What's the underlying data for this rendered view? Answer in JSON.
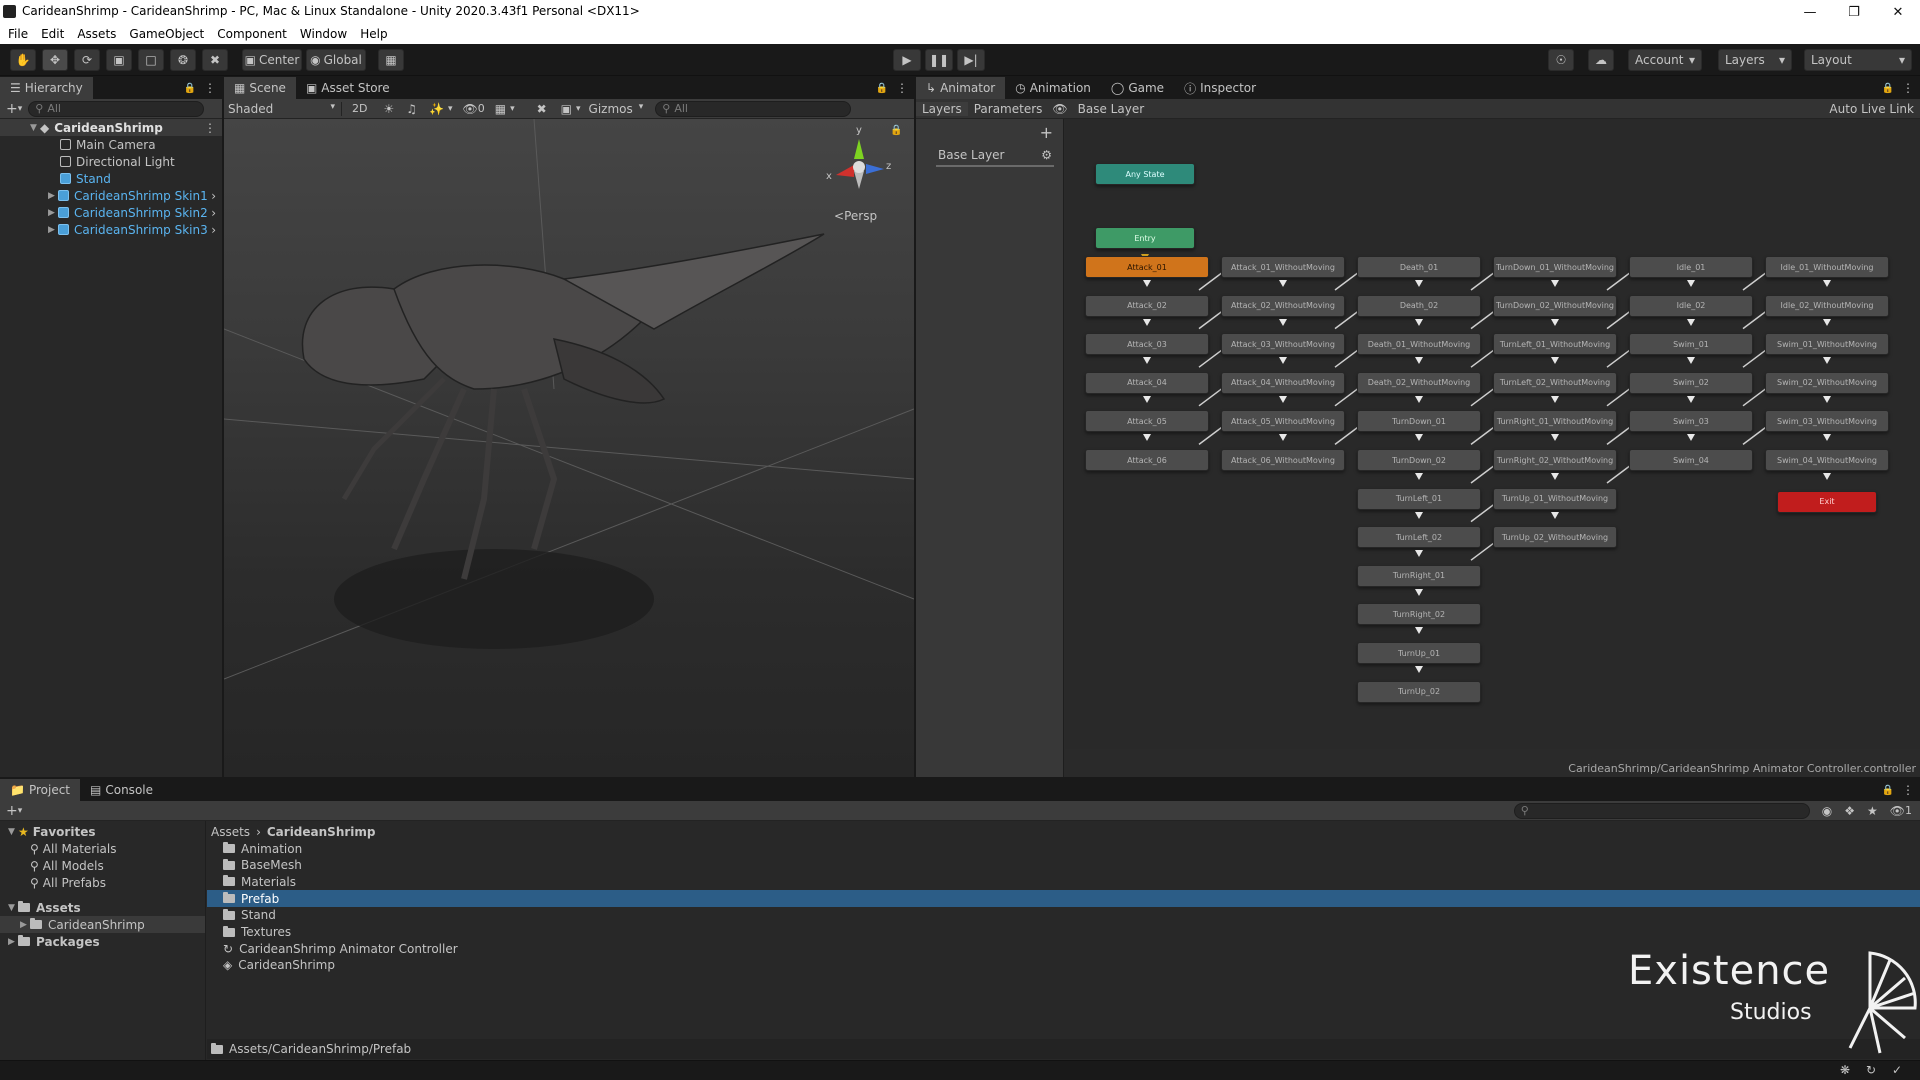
{
  "window": {
    "title": "CarideanShrimp - CarideanShrimp - PC, Mac & Linux Standalone - Unity 2020.3.43f1 Personal <DX11>"
  },
  "menu": [
    "File",
    "Edit",
    "Assets",
    "GameObject",
    "Component",
    "Window",
    "Help"
  ],
  "toolbar": {
    "pivot_label": "Center",
    "space_label": "Global",
    "account_label": "Account",
    "layers_label": "Layers",
    "layout_label": "Layout"
  },
  "hierarchy": {
    "tab_label": "Hierarchy",
    "search_placeholder": "All",
    "root": "CarideanShrimp",
    "items": [
      "Main Camera",
      "Directional Light",
      "Stand",
      "CarideanShrimp Skin1",
      "CarideanShrimp Skin2",
      "CarideanShrimp Skin3"
    ]
  },
  "scene": {
    "tabs": [
      "Scene",
      "Asset Store"
    ],
    "shading": "Shaded",
    "mode_2d": "2D",
    "hidden_count": "0",
    "gizmos": "Gizmos",
    "search_placeholder": "All",
    "persp_label": "Persp",
    "axis_x": "x",
    "axis_y": "y",
    "axis_z": "z"
  },
  "animator": {
    "tabs": [
      "Animator",
      "Animation",
      "Game",
      "Inspector"
    ],
    "subtabs": [
      "Layers",
      "Parameters"
    ],
    "breadcrumb": "Base Layer",
    "auto_live_link": "Auto Live Link",
    "layer_name": "Base Layer",
    "path": "CarideanShrimp/CarideanShrimp Animator Controller.controller",
    "special": {
      "any_state": "Any State",
      "entry": "Entry",
      "exit": "Exit"
    },
    "columns": [
      [
        "Attack_01",
        "Attack_02",
        "Attack_03",
        "Attack_04",
        "Attack_05",
        "Attack_06"
      ],
      [
        "Attack_01_WithoutMoving",
        "Attack_02_WithoutMoving",
        "Attack_03_WithoutMoving",
        "Attack_04_WithoutMoving",
        "Attack_05_WithoutMoving",
        "Attack_06_WithoutMoving"
      ],
      [
        "Death_01",
        "Death_02",
        "Death_01_WithoutMoving",
        "Death_02_WithoutMoving",
        "TurnDown_01",
        "TurnDown_02",
        "TurnLeft_01",
        "TurnLeft_02",
        "TurnRight_01",
        "TurnRight_02",
        "TurnUp_01",
        "TurnUp_02"
      ],
      [
        "TurnDown_01_WithoutMoving",
        "TurnDown_02_WithoutMoving",
        "TurnLeft_01_WithoutMoving",
        "TurnLeft_02_WithoutMoving",
        "TurnRight_01_WithoutMoving",
        "TurnRight_02_WithoutMoving",
        "TurnUp_01_WithoutMoving",
        "TurnUp_02_WithoutMoving"
      ],
      [
        "Idle_01",
        "Idle_02",
        "Swim_01",
        "Swim_02",
        "Swim_03",
        "Swim_04"
      ],
      [
        "Idle_01_WithoutMoving",
        "Idle_02_WithoutMoving",
        "Swim_01_WithoutMoving",
        "Swim_02_WithoutMoving",
        "Swim_03_WithoutMoving",
        "Swim_04_WithoutMoving"
      ]
    ],
    "colors": {
      "default_state": "#d0741b",
      "entry": "#3e9a66",
      "any_state": "#2e8a7a",
      "exit": "#c11d1d"
    }
  },
  "project": {
    "tabs": [
      "Project",
      "Console"
    ],
    "favorites_label": "Favorites",
    "favorites": [
      "All Materials",
      "All Models",
      "All Prefabs"
    ],
    "assets_label": "Assets",
    "asset_children": [
      "CarideanShrimp"
    ],
    "packages_label": "Packages",
    "breadcrumb": [
      "Assets",
      "CarideanShrimp"
    ],
    "items": [
      "Animation",
      "BaseMesh",
      "Materials",
      "Prefab",
      "Stand",
      "Textures",
      "CarideanShrimp Animator Controller",
      "CarideanShrimp"
    ],
    "selected_index": 3,
    "footer_path": "Assets/CarideanShrimp/Prefab",
    "hidden_count": "1"
  },
  "watermark": {
    "line1": "Existence",
    "line2": "Studios"
  },
  "accent": "#2c5d87"
}
